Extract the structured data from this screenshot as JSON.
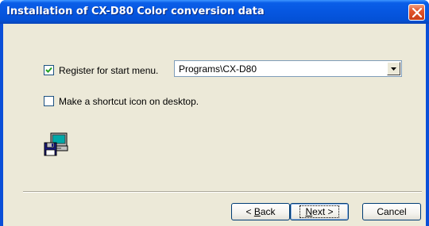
{
  "window": {
    "title": "Installation of CX-D80 Color conversion data",
    "title_color": "#0a5ee8",
    "close_icon": "close-x-icon"
  },
  "options": {
    "register_start_menu": {
      "label": "Register for start menu.",
      "checked": true
    },
    "start_menu_folder": {
      "value": "Programs\\CX-D80"
    },
    "desktop_shortcut": {
      "label": "Make a shortcut icon on desktop.",
      "checked": false
    }
  },
  "icon": {
    "name": "computer-floppy-icon"
  },
  "buttons": {
    "back": {
      "mnemonic": "B",
      "rest": "ack",
      "prefix": "< "
    },
    "next": {
      "mnemonic": "N",
      "rest": "ext",
      "suffix": " >"
    },
    "cancel": {
      "label": "Cancel"
    }
  }
}
